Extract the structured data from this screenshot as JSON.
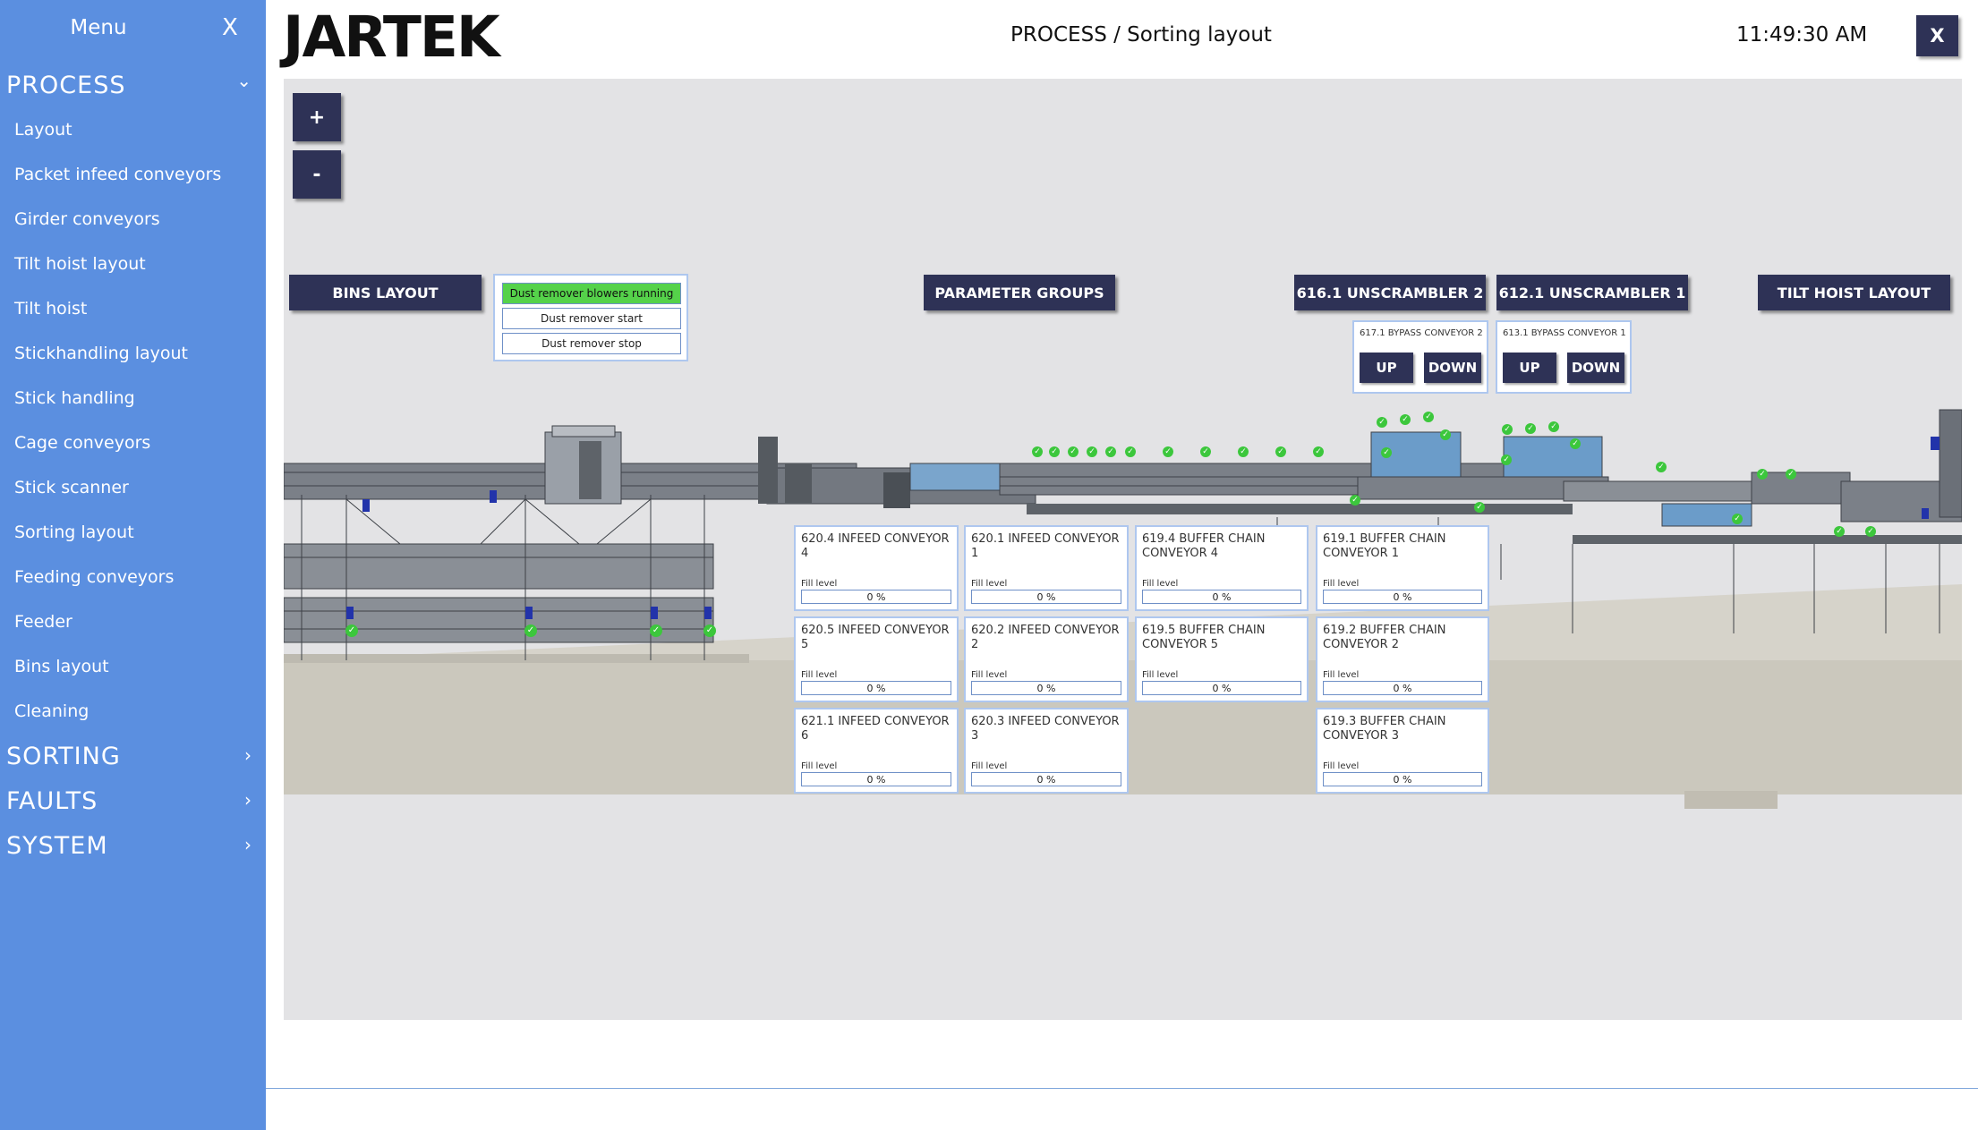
{
  "sidebar": {
    "title": "Menu",
    "close": "X",
    "sections": {
      "process": "PROCESS",
      "sorting": "SORTING",
      "faults": "FAULTS",
      "system": "SYSTEM"
    },
    "chev_down": "⌄",
    "chev_right": "›",
    "items": [
      {
        "label": "Layout"
      },
      {
        "label": "Packet infeed conveyors"
      },
      {
        "label": "Girder conveyors"
      },
      {
        "label": "Tilt hoist layout"
      },
      {
        "label": "Tilt hoist"
      },
      {
        "label": "Stickhandling layout"
      },
      {
        "label": "Stick handling"
      },
      {
        "label": "Cage conveyors"
      },
      {
        "label": "Stick scanner"
      },
      {
        "label": "Sorting layout"
      },
      {
        "label": "Feeding conveyors"
      },
      {
        "label": "Feeder"
      },
      {
        "label": "Bins layout"
      },
      {
        "label": "Cleaning"
      }
    ]
  },
  "header": {
    "logo": "JARTEK",
    "breadcrumb": "PROCESS / Sorting layout",
    "clock": "11:49:30 AM",
    "close": "X"
  },
  "zoom": {
    "in": "+",
    "out": "-"
  },
  "nav_buttons": {
    "bins": "BINS LAYOUT",
    "params": "PARAMETER GROUPS",
    "unscrambler2": "616.1 UNSCRAMBLER 2",
    "unscrambler1": "612.1 UNSCRAMBLER 1",
    "tilt": "TILT HOIST LAYOUT"
  },
  "dust_remover": {
    "running": "Dust remover blowers running",
    "start": "Dust remover start",
    "stop": "Dust remover stop"
  },
  "bypass": [
    {
      "title": "617.1 BYPASS CONVEYOR 2",
      "up": "UP",
      "down": "DOWN"
    },
    {
      "title": "613.1 BYPASS CONVEYOR 1",
      "up": "UP",
      "down": "DOWN"
    }
  ],
  "fill_label": "Fill level",
  "conveyors": [
    {
      "title": "620.4 INFEED CONVEYOR 4",
      "fill": "0 %"
    },
    {
      "title": "620.1 INFEED CONVEYOR 1",
      "fill": "0 %"
    },
    {
      "title": "619.4 BUFFER CHAIN CONVEYOR 4",
      "fill": "0 %"
    },
    {
      "title": "619.1 BUFFER CHAIN CONVEYOR 1",
      "fill": "0 %"
    },
    {
      "title": "620.5 INFEED CONVEYOR 5",
      "fill": "0 %"
    },
    {
      "title": "620.2 INFEED CONVEYOR 2",
      "fill": "0 %"
    },
    {
      "title": "619.5 BUFFER CHAIN CONVEYOR 5",
      "fill": "0 %"
    },
    {
      "title": "619.2 BUFFER CHAIN CONVEYOR 2",
      "fill": "0 %"
    },
    {
      "title": "621.1 INFEED CONVEYOR 6",
      "fill": "0 %"
    },
    {
      "title": "620.3 INFEED CONVEYOR 3",
      "fill": "0 %"
    },
    {
      "title": "619.3 BUFFER CHAIN CONVEYOR 3",
      "fill": "0 %"
    }
  ],
  "colors": {
    "sidebar": "#5b8fe0",
    "button": "#2e3256",
    "status_running": "#55d24a",
    "check": "#3cc73c",
    "canvas": "#e3e3e5",
    "floor": "#c9c6bb"
  },
  "icons": {
    "check": "✓"
  }
}
